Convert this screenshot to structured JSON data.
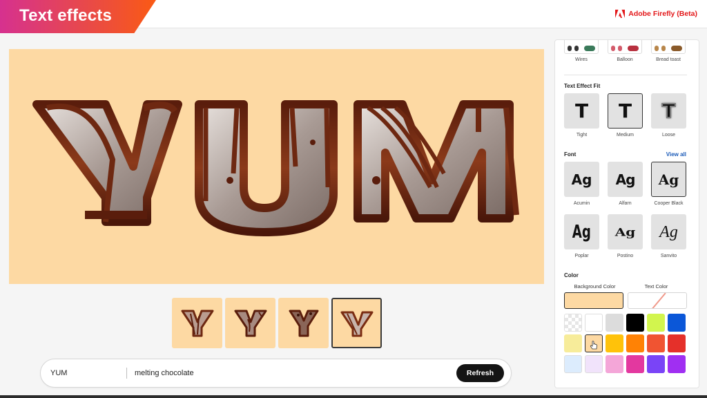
{
  "header": {
    "title": "Text effects",
    "brand": "Adobe Firefly (Beta)",
    "brand_icon": "adobe-logo-icon",
    "brand_color": "#e3181a",
    "banner_gradient": [
      "#d6318f",
      "#fa5a14"
    ]
  },
  "canvas": {
    "text": "YUM",
    "background_color": "#fdd9a3",
    "effect": "melting chocolate"
  },
  "thumbnails": [
    {
      "letter": "Y",
      "selected": false
    },
    {
      "letter": "Y",
      "selected": false
    },
    {
      "letter": "Y",
      "selected": false
    },
    {
      "letter": "Y",
      "selected": true
    }
  ],
  "prompt": {
    "text_value": "YUM",
    "style_value": "melting chocolate",
    "refresh_label": "Refresh"
  },
  "panel": {
    "styles": [
      {
        "label": "Wires"
      },
      {
        "label": "Balloon"
      },
      {
        "label": "Bread toast"
      }
    ],
    "fit": {
      "title": "Text Effect Fit",
      "options": [
        {
          "label": "Tight",
          "glyph": "T",
          "selected": false
        },
        {
          "label": "Medium",
          "glyph": "T",
          "selected": true
        },
        {
          "label": "Loose",
          "glyph": "T",
          "selected": false
        }
      ]
    },
    "font": {
      "title": "Font",
      "view_all_label": "View all",
      "options": [
        {
          "label": "Acumin",
          "glyph": "Ag",
          "selected": false
        },
        {
          "label": "Alfarn",
          "glyph": "Ag",
          "selected": false
        },
        {
          "label": "Cooper Black",
          "glyph": "Ag",
          "selected": true
        },
        {
          "label": "Poplar",
          "glyph": "Ag",
          "selected": false
        },
        {
          "label": "Postino",
          "glyph": "Ag",
          "selected": false
        },
        {
          "label": "Sanvito",
          "glyph": "Ag",
          "selected": false
        }
      ]
    },
    "color": {
      "title": "Color",
      "background_label": "Background Color",
      "text_label": "Text Color",
      "background_value": "#fdd9a3",
      "text_value": "none",
      "swatches": [
        {
          "name": "transparent",
          "hex": "transparent"
        },
        {
          "name": "white",
          "hex": "#ffffff"
        },
        {
          "name": "light-gray",
          "hex": "#dcdcdc"
        },
        {
          "name": "black",
          "hex": "#000000"
        },
        {
          "name": "lime",
          "hex": "#d2f54e"
        },
        {
          "name": "blue",
          "hex": "#0b57d8"
        },
        {
          "name": "pale-yellow",
          "hex": "#f7ec9a"
        },
        {
          "name": "peach",
          "hex": "#fdd9a3",
          "selected": true
        },
        {
          "name": "amber",
          "hex": "#ffc20a"
        },
        {
          "name": "orange",
          "hex": "#ff8205"
        },
        {
          "name": "red-orange",
          "hex": "#f05432"
        },
        {
          "name": "red",
          "hex": "#e5302a"
        },
        {
          "name": "pale-blue",
          "hex": "#dcecfd"
        },
        {
          "name": "pale-lavender",
          "hex": "#f1e3fb"
        },
        {
          "name": "pink",
          "hex": "#f4a6d8"
        },
        {
          "name": "magenta",
          "hex": "#e3389f"
        },
        {
          "name": "violet",
          "hex": "#7a44f7"
        },
        {
          "name": "purple",
          "hex": "#a02ff2"
        }
      ]
    }
  }
}
